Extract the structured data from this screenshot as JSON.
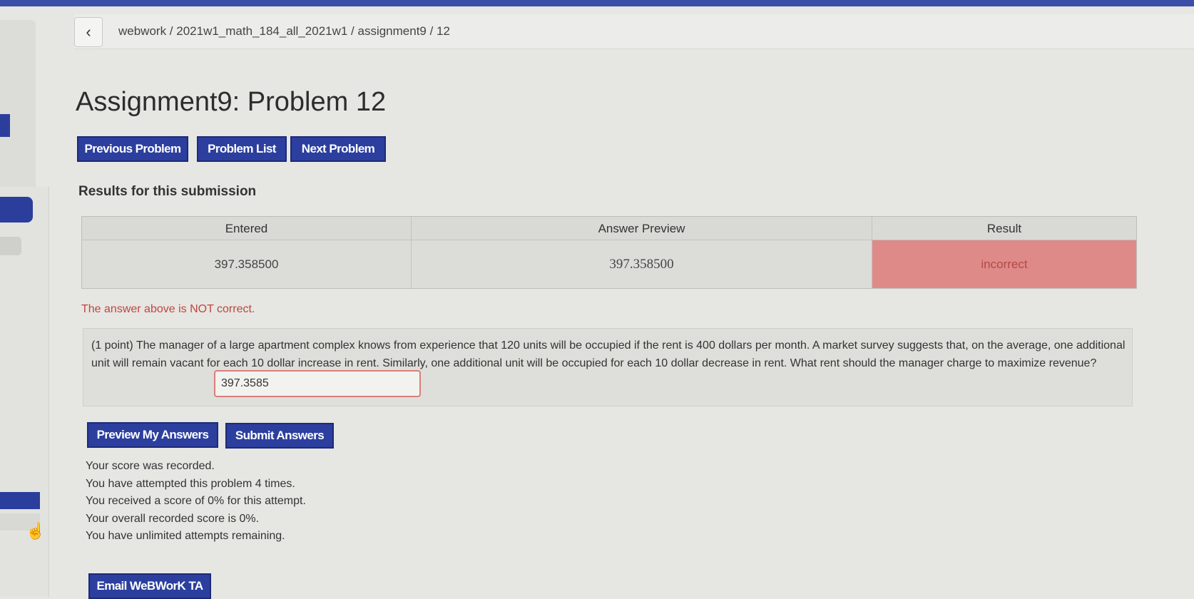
{
  "breadcrumb": {
    "back_icon": "chevron-left-icon",
    "path": "webwork / 2021w1_math_184_all_2021w1 / assignment9 / 12"
  },
  "page": {
    "title": "Assignment9: Problem 12"
  },
  "nav_buttons": {
    "previous": "Previous Problem",
    "list": "Problem List",
    "next": "Next Problem"
  },
  "results": {
    "heading": "Results for this submission",
    "columns": [
      "Entered",
      "Answer Preview",
      "Result"
    ],
    "row": {
      "entered": "397.358500",
      "preview": "397.358500",
      "result": "incorrect"
    },
    "message": "The answer above is NOT correct."
  },
  "problem": {
    "text": "(1 point) The manager of a large apartment complex knows from experience that 120 units will be occupied if the rent is 400 dollars per month. A market survey suggests that, on the average, one additional unit will remain vacant for each 10 dollar increase in rent. Similarly, one additional unit will be occupied for each 10 dollar decrease in rent. What rent should the manager charge to maximize revenue?",
    "answer_value": "397.3585"
  },
  "action_buttons": {
    "preview": "Preview My Answers",
    "submit": "Submit Answers",
    "email": "Email WeBWorK TA"
  },
  "status": [
    "Your score was recorded.",
    "You have attempted this problem 4 times.",
    "You received a score of 0% for this attempt.",
    "Your overall recorded score is 0%.",
    "You have unlimited attempts remaining."
  ],
  "colors": {
    "button": "#2c3f9e",
    "incorrect_bg": "#de8a88",
    "error_text": "#c0463c"
  }
}
